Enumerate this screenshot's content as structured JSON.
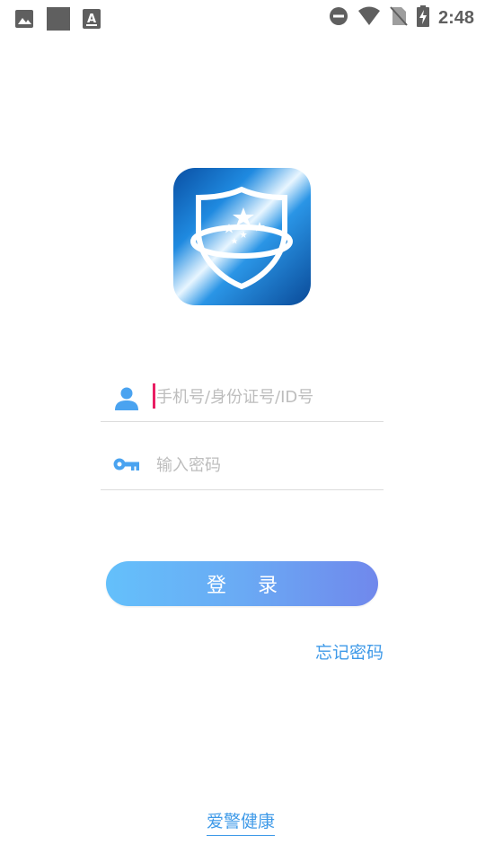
{
  "status_bar": {
    "time": "2:48",
    "left_icons": [
      "image-icon",
      "square-icon",
      "font-a-icon"
    ],
    "right_icons": [
      "do-not-disturb-icon",
      "wifi-icon",
      "no-sim-icon",
      "battery-charging-icon"
    ]
  },
  "login": {
    "username_placeholder": "手机号/身份证号/ID号",
    "password_placeholder": "输入密码",
    "login_label": "登 录",
    "forgot_label": "忘记密码"
  },
  "footer": {
    "brand_label": "爱警健康"
  },
  "colors": {
    "accent": "#3f9ae8",
    "button_gradient_start": "#64c0fb",
    "button_gradient_end": "#7088ec",
    "cursor": "#e91e63"
  }
}
